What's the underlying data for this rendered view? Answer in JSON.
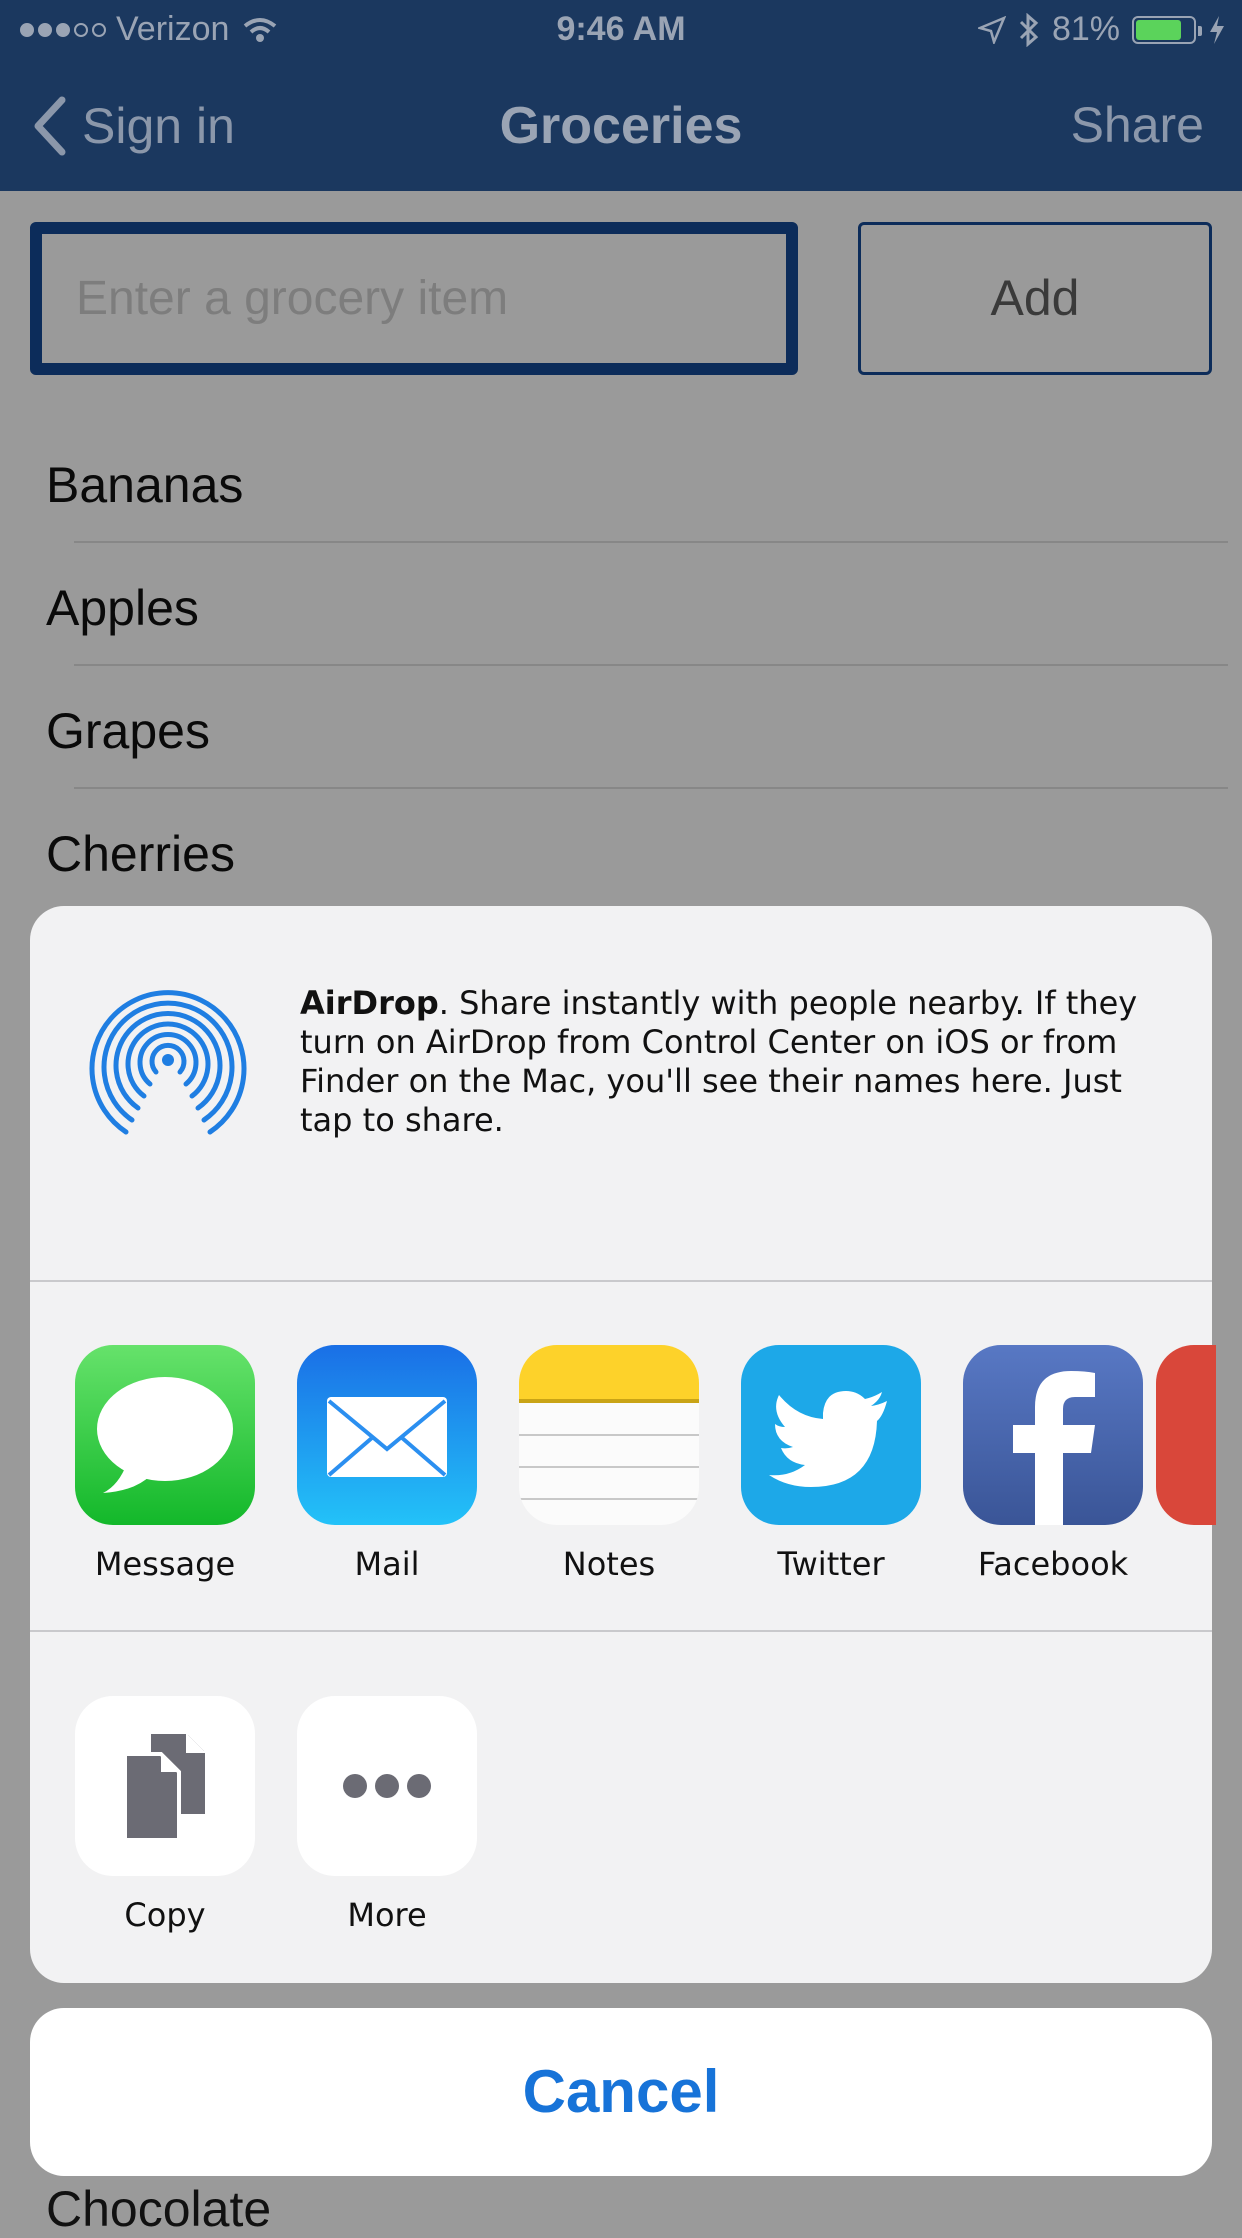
{
  "status_bar": {
    "carrier": "Verizon",
    "time": "9:46 AM",
    "battery_percent": "81%",
    "signal_bars_filled": 3,
    "signal_bars_total": 5,
    "battery_level": 0.81,
    "battery_color": "#5bd35b"
  },
  "nav": {
    "back_label": "Sign in",
    "title": "Groceries",
    "share_label": "Share",
    "background": "#1b385f"
  },
  "input": {
    "placeholder": "Enter a grocery item",
    "add_label": "Add"
  },
  "list": {
    "items": [
      "Bananas",
      "Apples",
      "Grapes",
      "Cherries"
    ],
    "peek": "Chocolate"
  },
  "share_sheet": {
    "airdrop_title": "AirDrop",
    "airdrop_description": ". Share instantly with people nearby. If they turn on AirDrop from Control Center on iOS or from Finder on the Mac, you'll see their names here. Just tap to share.",
    "apps": [
      {
        "label": "Message",
        "icon": "message-icon"
      },
      {
        "label": "Mail",
        "icon": "mail-icon"
      },
      {
        "label": "Notes",
        "icon": "notes-icon"
      },
      {
        "label": "Twitter",
        "icon": "twitter-icon"
      },
      {
        "label": "Facebook",
        "icon": "facebook-icon"
      }
    ],
    "actions": [
      {
        "label": "Copy",
        "icon": "copy-icon"
      },
      {
        "label": "More",
        "icon": "more-icon"
      }
    ],
    "cancel_label": "Cancel",
    "accent_color": "#1773d8"
  }
}
